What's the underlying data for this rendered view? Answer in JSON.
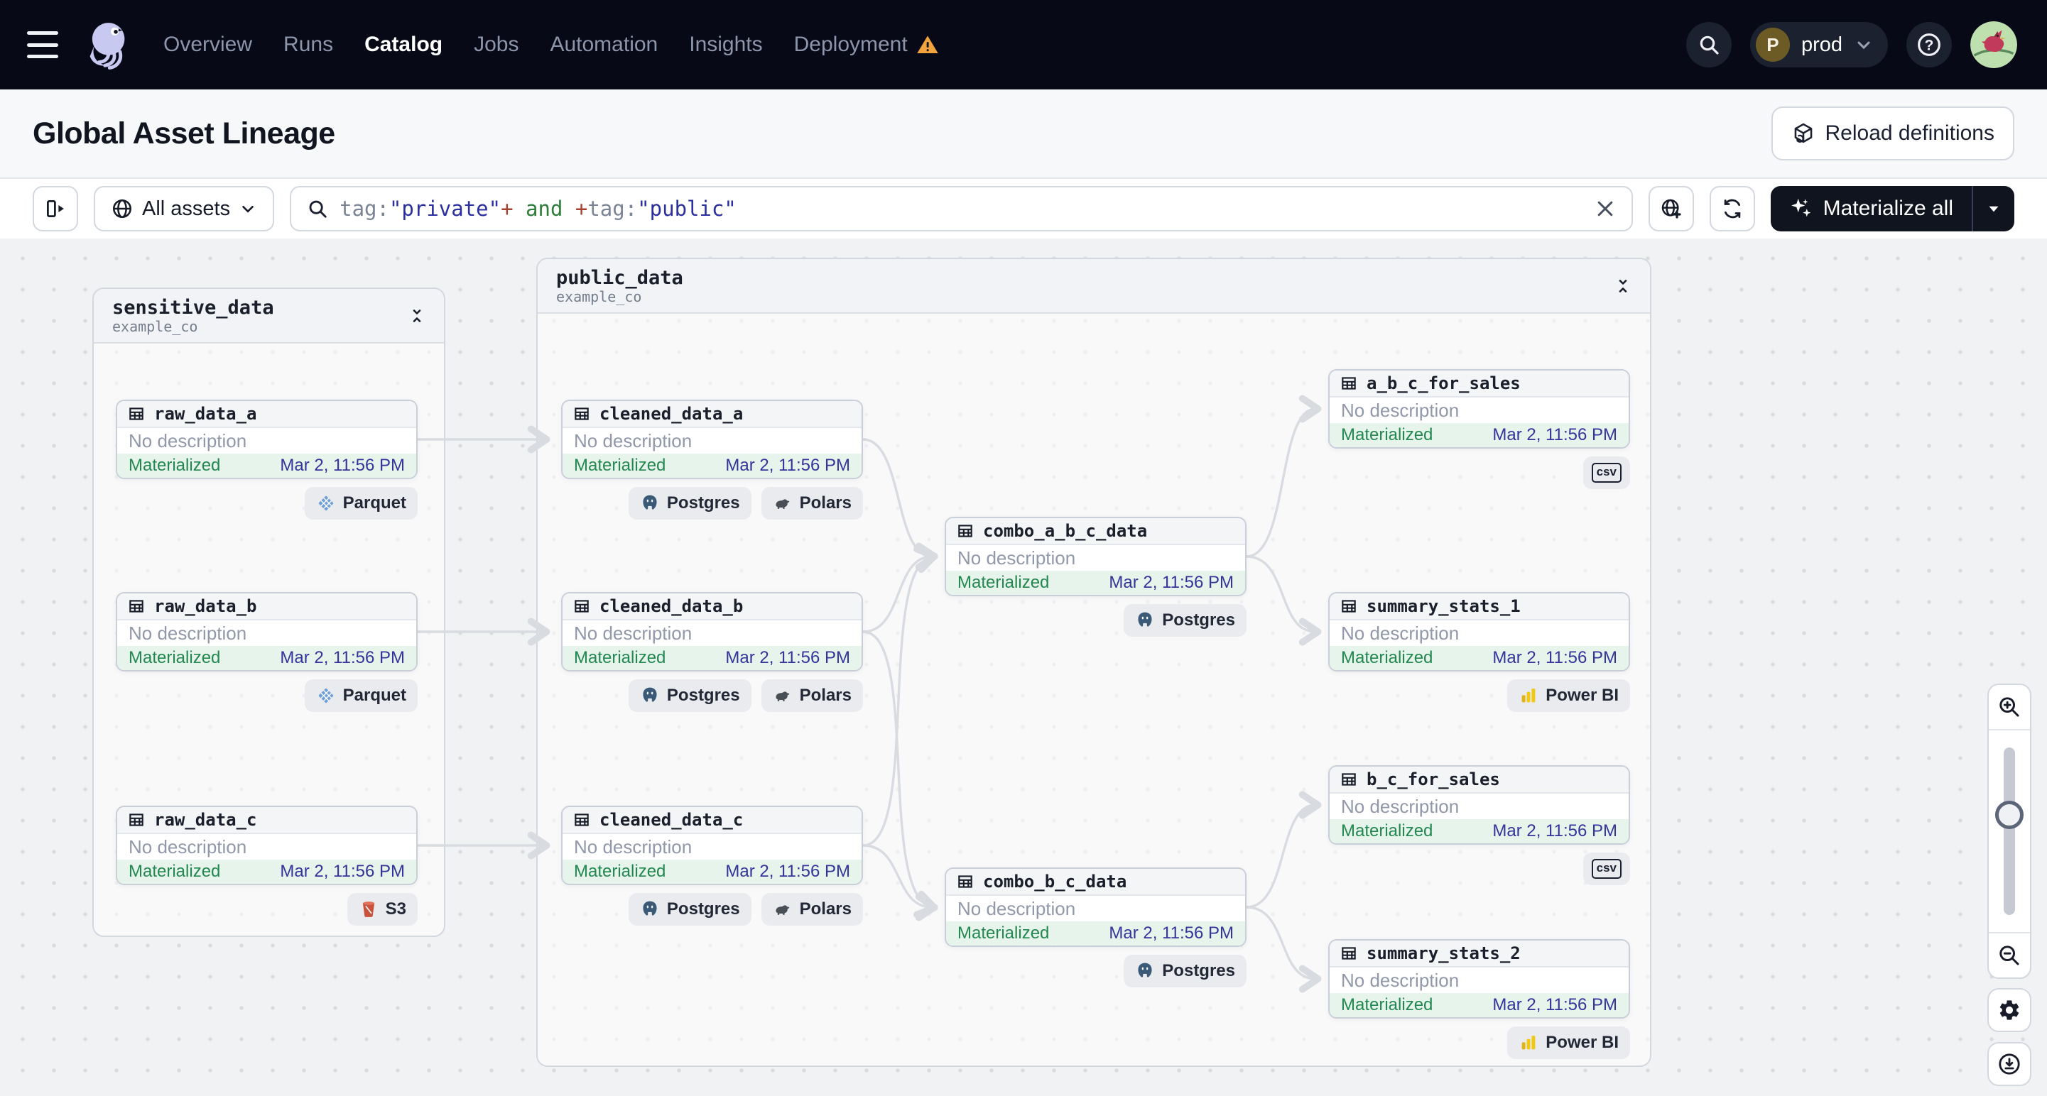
{
  "nav": {
    "menu": [
      {
        "label": "Overview"
      },
      {
        "label": "Runs"
      },
      {
        "label": "Catalog"
      },
      {
        "label": "Jobs"
      },
      {
        "label": "Automation"
      },
      {
        "label": "Insights"
      },
      {
        "label": "Deployment"
      }
    ],
    "env": {
      "letter": "P",
      "name": "prod"
    }
  },
  "header": {
    "title": "Global Asset Lineage",
    "reload_label": "Reload definitions"
  },
  "toolbar": {
    "scope": "All assets",
    "query": [
      {
        "text": "tag:"
      },
      {
        "text": "\"private\""
      },
      {
        "text": "+"
      },
      {
        "text": " and "
      },
      {
        "text": "+"
      },
      {
        "text": "tag:"
      },
      {
        "text": "\"public\""
      }
    ],
    "materialize_label": "Materialize all"
  },
  "graph": {
    "groups": [
      {
        "name": "sensitive_data",
        "location": "example_co"
      },
      {
        "name": "public_data",
        "location": "example_co"
      }
    ],
    "assets": [
      {
        "name": "raw_data_a",
        "description": "No description",
        "status": "Materialized",
        "timestamp": "Mar 2, 11:56 PM",
        "tags": [
          {
            "label": "Parquet"
          }
        ]
      },
      {
        "name": "raw_data_b",
        "description": "No description",
        "status": "Materialized",
        "timestamp": "Mar 2, 11:56 PM",
        "tags": [
          {
            "label": "Parquet"
          }
        ]
      },
      {
        "name": "raw_data_c",
        "description": "No description",
        "status": "Materialized",
        "timestamp": "Mar 2, 11:56 PM",
        "tags": [
          {
            "label": "S3"
          }
        ]
      },
      {
        "name": "cleaned_data_a",
        "description": "No description",
        "status": "Materialized",
        "timestamp": "Mar 2, 11:56 PM",
        "tags": [
          {
            "label": "Postgres"
          },
          {
            "label": "Polars"
          }
        ]
      },
      {
        "name": "cleaned_data_b",
        "description": "No description",
        "status": "Materialized",
        "timestamp": "Mar 2, 11:56 PM",
        "tags": [
          {
            "label": "Postgres"
          },
          {
            "label": "Polars"
          }
        ]
      },
      {
        "name": "cleaned_data_c",
        "description": "No description",
        "status": "Materialized",
        "timestamp": "Mar 2, 11:56 PM",
        "tags": [
          {
            "label": "Postgres"
          },
          {
            "label": "Polars"
          }
        ]
      },
      {
        "name": "combo_a_b_c_data",
        "description": "No description",
        "status": "Materialized",
        "timestamp": "Mar 2, 11:56 PM",
        "tags": [
          {
            "label": "Postgres"
          }
        ]
      },
      {
        "name": "combo_b_c_data",
        "description": "No description",
        "status": "Materialized",
        "timestamp": "Mar 2, 11:56 PM",
        "tags": [
          {
            "label": "Postgres"
          }
        ]
      },
      {
        "name": "a_b_c_for_sales",
        "description": "No description",
        "status": "Materialized",
        "timestamp": "Mar 2, 11:56 PM",
        "tags": [
          {
            "label": "csv"
          }
        ]
      },
      {
        "name": "summary_stats_1",
        "description": "No description",
        "status": "Materialized",
        "timestamp": "Mar 2, 11:56 PM",
        "tags": [
          {
            "label": "Power BI"
          }
        ]
      },
      {
        "name": "b_c_for_sales",
        "description": "No description",
        "status": "Materialized",
        "timestamp": "Mar 2, 11:56 PM",
        "tags": [
          {
            "label": "csv"
          }
        ]
      },
      {
        "name": "summary_stats_2",
        "description": "No description",
        "status": "Materialized",
        "timestamp": "Mar 2, 11:56 PM",
        "tags": [
          {
            "label": "Power BI"
          }
        ]
      }
    ]
  },
  "colors": {
    "status_green": "#238750",
    "timestamp_indigo": "#34349b",
    "warning_orange": "#f2a33c",
    "nav_bg": "#070a16"
  }
}
